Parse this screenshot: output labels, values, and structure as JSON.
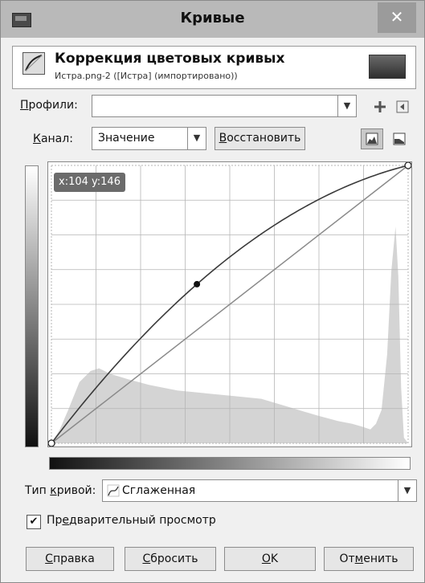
{
  "window": {
    "title": "Кривые",
    "close_glyph": "✕"
  },
  "header": {
    "title": "Коррекция цветовых кривых",
    "subtitle": "Истра.png-2 ([Истра] (импортировано))",
    "icon": "curves-icon"
  },
  "profiles": {
    "label": "Профили:",
    "value": "",
    "add_icon": "plus-icon",
    "menu_icon": "menu-icon"
  },
  "channel": {
    "label": "Канал:",
    "value": "Значение",
    "reset_button": "Восстановить",
    "linear_hist_icon": "linear-histogram-icon",
    "log_hist_icon": "log-histogram-icon"
  },
  "curve": {
    "coord_readout": "x:104 y:146",
    "control_points": [
      [
        0,
        0
      ],
      [
        104,
        146
      ],
      [
        255,
        255
      ]
    ]
  },
  "curve_type": {
    "label": "Тип кривой:",
    "value": "Сглаженная",
    "icon": "smooth-curve-icon"
  },
  "preview": {
    "label": "Предварительный просмотр",
    "checked": true
  },
  "buttons": {
    "help": "Справка",
    "reset": "Сбросить",
    "ok": "OK",
    "cancel": "Отменить"
  },
  "colors": {
    "titlebar": "#b9b9b9",
    "histogram": "#d4d4d4",
    "curve": "#3a3a3a",
    "diagonal": "#8a8a8a"
  }
}
